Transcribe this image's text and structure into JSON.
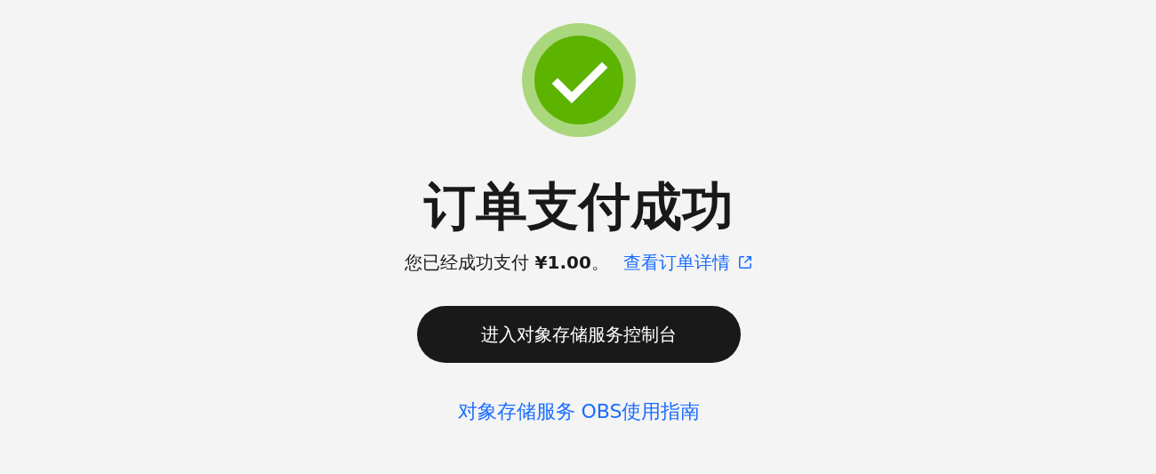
{
  "status": {
    "kind": "success"
  },
  "title": "订单支付成功",
  "message": "您已经成功支付 **¥1.00**。",
  "detail_link": "查看订单详情",
  "primary_button": "进入对象存储服务控制台",
  "guide_link": "对象存储服务 OBS使用指南"
}
